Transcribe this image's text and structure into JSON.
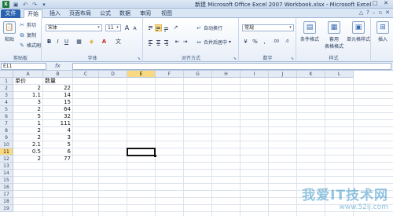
{
  "titlebar": {
    "title": "新建 Microsoft Office Excel 2007 Workbook.xlsx - Microsoft Excel",
    "logo": "X",
    "qat": [
      "save-icon",
      "undo-icon",
      "redo-icon",
      "customize-icon"
    ],
    "win_min": "–",
    "win_max": "□",
    "win_close": "✕"
  },
  "tabs": {
    "file": "文件",
    "items": [
      "开始",
      "插入",
      "页面布局",
      "公式",
      "数据",
      "审阅",
      "视图"
    ],
    "help": "?"
  },
  "ribbon": {
    "clipboard": {
      "label": "剪贴板",
      "paste": "粘贴",
      "cut": "剪切",
      "copy": "复制",
      "painter": "格式刷"
    },
    "font": {
      "label": "字体",
      "name": "宋体",
      "size": "11",
      "bold": "B",
      "italic": "I",
      "underline": "U",
      "grow": "A",
      "shrink": "A",
      "wen": "文"
    },
    "alignment": {
      "label": "对齐方式",
      "wrap": "自动换行",
      "merge": "合并后居中"
    },
    "number": {
      "label": "数字",
      "format": "常规",
      "currency": "¥",
      "percent": "%",
      "comma": ",",
      "inc": ".00",
      "dec": ".0"
    },
    "styles": {
      "label": "样式",
      "conditional": "条件格式",
      "table": "套用\n表格格式",
      "table_1": "套用",
      "table_2": "表格格式",
      "cell": "单元格样式"
    },
    "cells": {
      "insert": "插入"
    }
  },
  "formula_bar": {
    "name_box": "E11",
    "fx": "fx",
    "content": ""
  },
  "grid": {
    "columns": [
      "A",
      "B",
      "C",
      "D",
      "E",
      "F",
      "G",
      "H",
      "I",
      "J",
      "K",
      "L"
    ],
    "rows": [
      "1",
      "2",
      "3",
      "4",
      "5",
      "6",
      "7",
      "8",
      "9",
      "10",
      "11",
      "12",
      "13",
      "14",
      "15",
      "16",
      "17",
      "18",
      "19"
    ],
    "selected_column": "E",
    "selected_row": "11",
    "header_row": [
      "单价",
      "数量"
    ],
    "data": [
      [
        "2",
        "22"
      ],
      [
        "1.1",
        "14"
      ],
      [
        "3",
        "15"
      ],
      [
        "2",
        "64"
      ],
      [
        "5",
        "32"
      ],
      [
        "1",
        "111"
      ],
      [
        "2",
        "4"
      ],
      [
        "2",
        "3"
      ],
      [
        "2.1",
        "5"
      ],
      [
        "0.5",
        "6"
      ],
      [
        "2",
        "77"
      ]
    ]
  },
  "watermark": {
    "main": "我爱IT技术网",
    "url": "www.52ij.com"
  }
}
